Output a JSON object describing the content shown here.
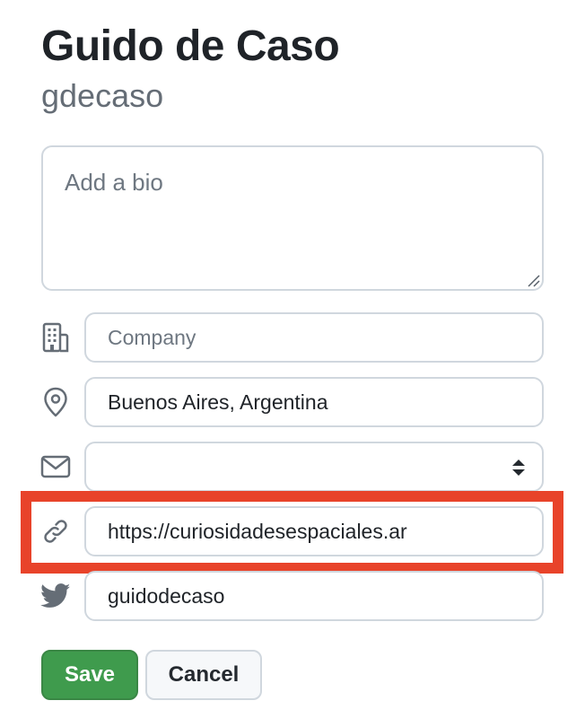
{
  "profile": {
    "name": "Guido de Caso",
    "login": "gdecaso"
  },
  "bio": {
    "placeholder": "Add a bio",
    "value": ""
  },
  "fields": {
    "company": {
      "icon": "building-icon",
      "placeholder": "Company",
      "value": ""
    },
    "location": {
      "icon": "location-pin-icon",
      "value": "Buenos Aires, Argentina"
    },
    "email": {
      "icon": "mail-icon",
      "value": ""
    },
    "website": {
      "icon": "link-icon",
      "value": "https://curiosidadesespaciales.ar"
    },
    "twitter": {
      "icon": "twitter-bird-icon",
      "value": "guidodecaso"
    }
  },
  "actions": {
    "save_label": "Save",
    "cancel_label": "Cancel"
  },
  "colors": {
    "highlight_border": "#e8432a",
    "save_button": "#3f9b4d",
    "icon_gray": "#656d76"
  }
}
